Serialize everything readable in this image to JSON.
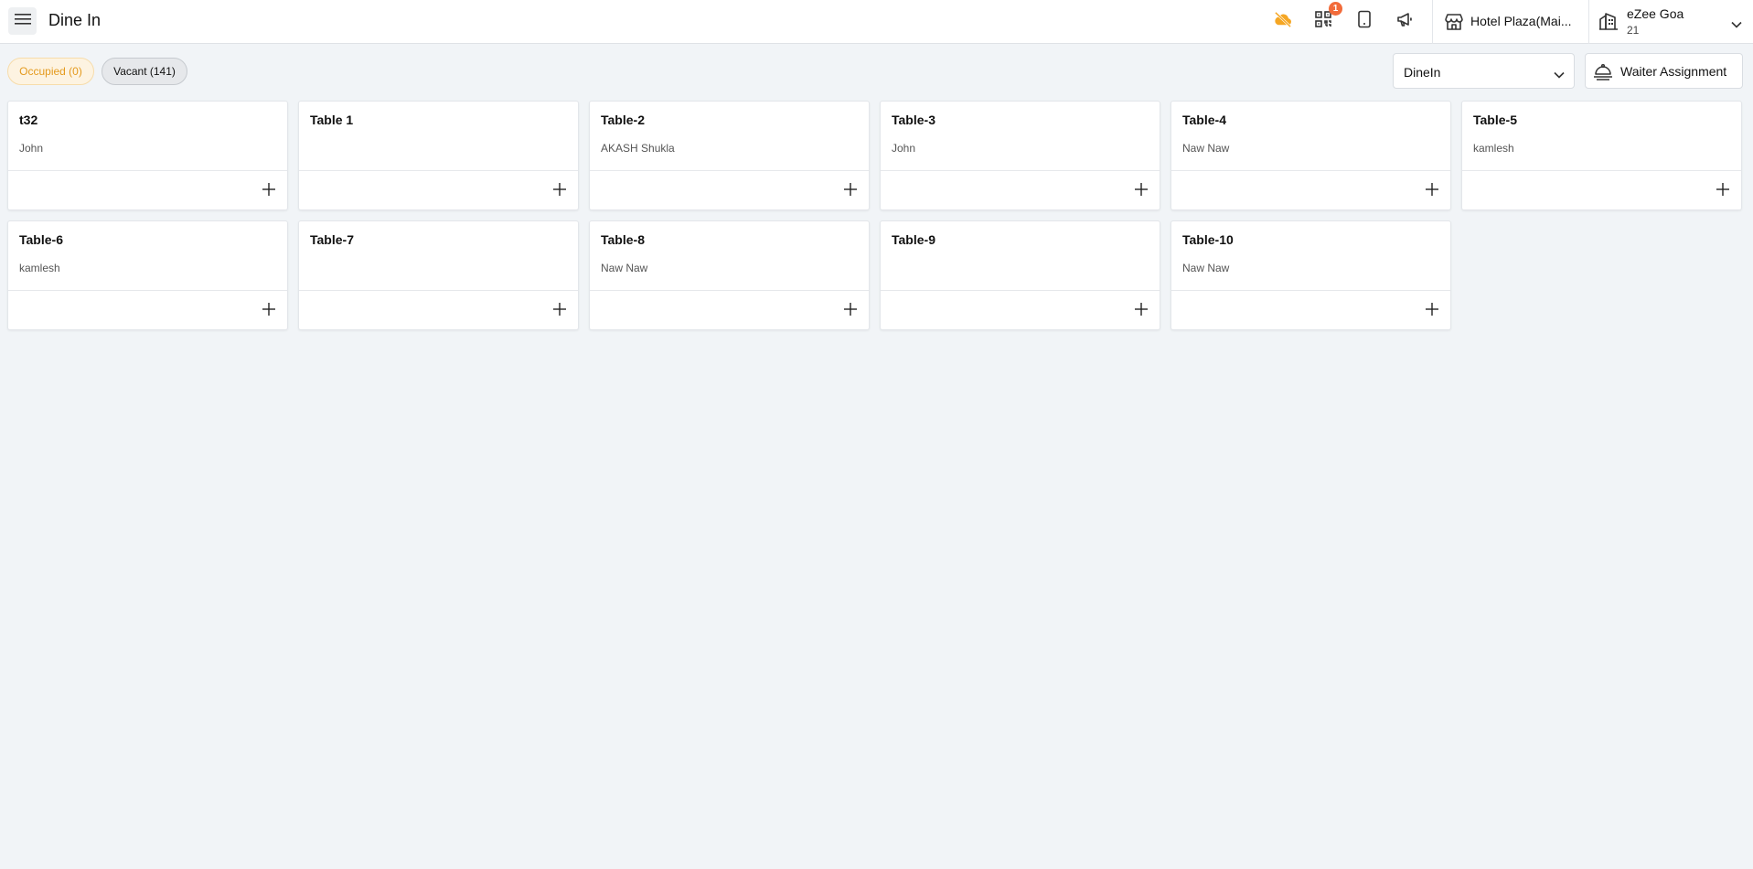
{
  "header": {
    "title": "Dine In",
    "icons": [
      "menu-icon",
      "cloud-off-icon",
      "qr-code-icon",
      "tablet-icon",
      "megaphone-icon",
      "store-icon",
      "building-icon",
      "chevron-down-icon"
    ],
    "qr_badge": "1",
    "store_name": "Hotel Plaza(Mai...",
    "property_name": "eZee Goa",
    "property_sub": "21",
    "accent_offline": "#f5a623"
  },
  "filters": {
    "occupied_label": "Occupied (0)",
    "vacant_label": "Vacant (141)",
    "service_value": "DineIn",
    "waiter_label": "Waiter Assignment"
  },
  "tables": [
    {
      "name": "t32",
      "waiter": "John"
    },
    {
      "name": "Table 1",
      "waiter": ""
    },
    {
      "name": "Table-2",
      "waiter": "AKASH Shukla"
    },
    {
      "name": "Table-3",
      "waiter": "John"
    },
    {
      "name": "Table-4",
      "waiter": "Naw Naw"
    },
    {
      "name": "Table-5",
      "waiter": "kamlesh"
    },
    {
      "name": "Table-6",
      "waiter": "kamlesh"
    },
    {
      "name": "Table-7",
      "waiter": ""
    },
    {
      "name": "Table-8",
      "waiter": "Naw Naw"
    },
    {
      "name": "Table-9",
      "waiter": ""
    },
    {
      "name": "Table-10",
      "waiter": "Naw Naw"
    }
  ]
}
